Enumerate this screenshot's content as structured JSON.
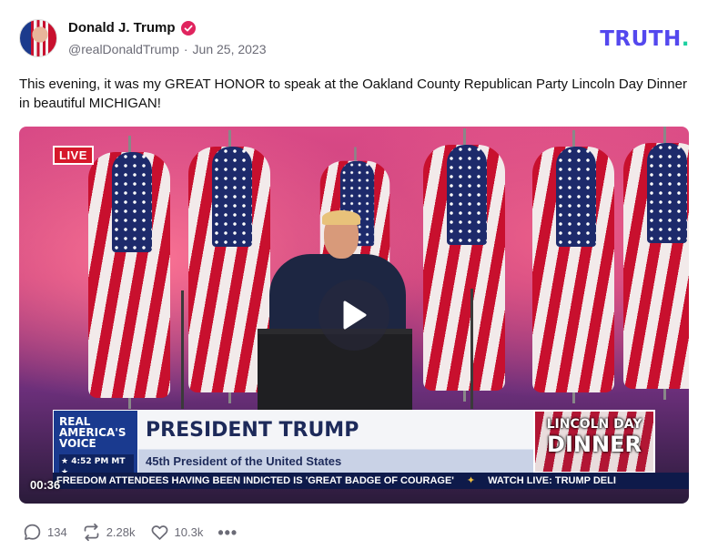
{
  "author": {
    "display_name": "Donald J. Trump",
    "handle": "@realDonaldTrump",
    "separator": "·",
    "date": "Jun 25, 2023"
  },
  "brand": {
    "logo_text": "TRUTH",
    "logo_dot": ".",
    "color": "#5448EE",
    "dot_color": "#1DD1A1"
  },
  "post": {
    "text": "This evening, it was my GREAT HONOR to speak at the Oakland County Republican Party Lincoln Day Dinner in beautiful MICHIGAN!"
  },
  "video": {
    "live_badge": "LIVE",
    "duration": "00:36",
    "chyron": {
      "network_line1": "REAL",
      "network_line2": "AMERICA'S",
      "network_line3": "VOICE",
      "network_time": "★ 4:52 PM MT ★",
      "title": "PRESIDENT TRUMP",
      "subtitle": "45th President of the United States",
      "event_line1": "LINCOLN DAY",
      "event_line2": "DINNER"
    },
    "ticker": {
      "item1": "FREEDOM ATTENDEES HAVING BEEN INDICTED IS 'GREAT BADGE OF COURAGE'",
      "item2": "WATCH LIVE: TRUMP DELI"
    }
  },
  "actions": {
    "replies": "134",
    "retruths": "2.28k",
    "likes": "10.3k",
    "more": "•••"
  },
  "icons": {
    "verified": "verified-badge-icon",
    "reply": "reply-icon",
    "retruth": "retruth-icon",
    "like": "heart-icon",
    "more": "more-icon",
    "play": "play-icon"
  },
  "colors": {
    "verified": "#E0245E",
    "muted": "#6B6B76"
  }
}
